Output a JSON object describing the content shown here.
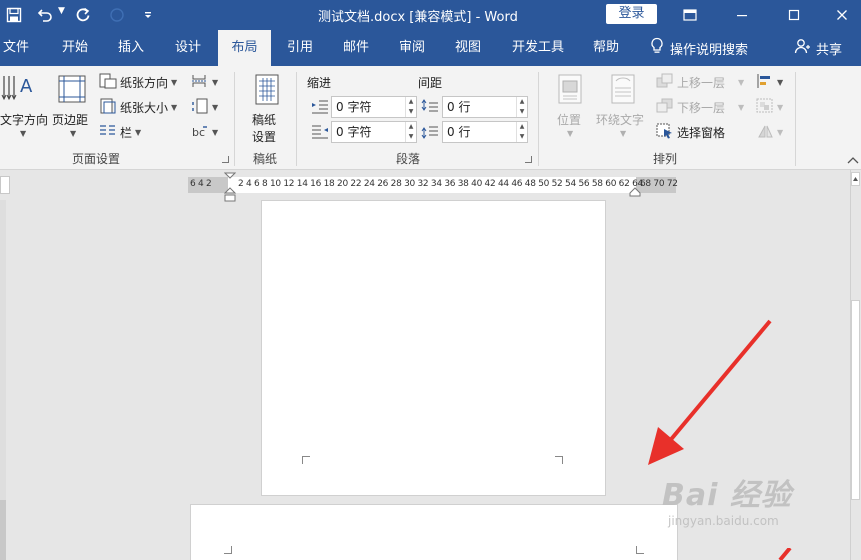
{
  "app": {
    "title": "测试文档.docx [兼容模式]  -  Word",
    "login_label": "登录"
  },
  "tabs": [
    {
      "label": "文件"
    },
    {
      "label": "开始"
    },
    {
      "label": "插入"
    },
    {
      "label": "设计"
    },
    {
      "label": "布局",
      "active": true
    },
    {
      "label": "引用"
    },
    {
      "label": "邮件"
    },
    {
      "label": "审阅"
    },
    {
      "label": "视图"
    },
    {
      "label": "开发工具"
    },
    {
      "label": "帮助"
    }
  ],
  "tell_me": "操作说明搜索",
  "share_label": "共享",
  "ribbon": {
    "page_setup": {
      "label": "页面设置",
      "text_direction": "文字方向",
      "margins": "页边距",
      "orientation": "纸张方向",
      "size": "纸张大小",
      "columns": "栏"
    },
    "manuscript": {
      "label": "稿纸",
      "button_line1": "稿纸",
      "button_line2": "设置"
    },
    "paragraph": {
      "label": "段落",
      "indent_title": "缩进",
      "spacing_title": "间距",
      "indent_left": "0 字符",
      "indent_right": "0 字符",
      "spacing_before": "0 行",
      "spacing_after": "0 行"
    },
    "arrange": {
      "label": "排列",
      "position": "位置",
      "wrap_text": "环绕文字",
      "bring_forward": "上移一层",
      "send_backward": "下移一层",
      "selection_pane": "选择窗格"
    }
  },
  "ruler": {
    "left_numbers": "6  4  2",
    "numbers": "2  4  6  8 10 12 14 16 18 20 22 24 26 28 30 32 34 36 38 40 42 44 46 48 50 52 54 56 58 60 62 64",
    "right_numbers": "68 70 72"
  },
  "watermark": {
    "main": "Bai 经验",
    "sub": "jingyan.baidu.com"
  },
  "colors": {
    "accent": "#2b579a",
    "arrow": "#e8302a"
  }
}
